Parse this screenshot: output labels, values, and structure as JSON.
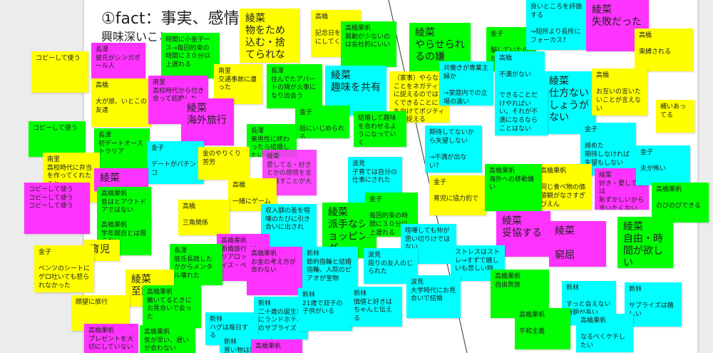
{
  "board": {
    "title": "①fact：事実、感情",
    "subtitle": "興味深いこと",
    "colors": {
      "yellow": "#ffff00",
      "green": "#00ff00",
      "cyan": "#00ffff",
      "magenta": "#ff33ff",
      "canvas": "#ffffff",
      "background": "#ececec"
    }
  },
  "notes": [
    {
      "text": "綾菜\n物をため込む・捨てられない"
    },
    {
      "text": "高橋\n\n記念日を大事にしてくれる"
    },
    {
      "text": "高橋果帆\n異動が少ないのは会社的にいい"
    },
    {
      "text": "綾菜\nやらせられるの嫌"
    },
    {
      "text": "金子\n\n騙していたのがショック"
    },
    {
      "text": "良いところを評価する\n\n→短所より長所にフォーカス？"
    },
    {
      "text": "綾菜\n失敗だった"
    },
    {
      "text": "高橋\n\n束縛される"
    },
    {
      "text": "時間に小金子ース→毎回約束の時間に３０分以上遅れる"
    },
    {
      "text": "長澤\n彼氏がシンガポール人"
    },
    {
      "text": "コピーして使う"
    },
    {
      "text": "高橋\n\n大が旅、いとこの友達"
    },
    {
      "text": "南里\n高校時代から付き合って結婚した"
    },
    {
      "text": "南里\n交通事故に遭った"
    },
    {
      "text": "長澤\n住んでたアパートの隣が火事になり出会う"
    },
    {
      "text": "綾菜\n趣味を共有"
    },
    {
      "text": "（家事）やらないことをネガティブに捉えるのではなくできることに目を向けてポジティブに捉える"
    },
    {
      "text": "共働きが専業主婦か\n\n→家庭内での立場の違い"
    },
    {
      "text": "高橋\n\n不満がない"
    },
    {
      "text": "綾菜\n仕方ないしょうがない"
    },
    {
      "text": "高橋\n\nお互いの言いたいことが言えない"
    },
    {
      "text": "できることだけやればいい。それが不満になるならことはない"
    },
    {
      "text": "綾菜\n海外旅行"
    },
    {
      "text": "金子\n\n話にいじめられる"
    },
    {
      "text": "結婚して趣味を合わせるようになっていく"
    },
    {
      "text": "期待してないから失望しない\n\n→不満が出ない？"
    },
    {
      "text": "金子\n\n諦めた\n期待しなければ失望もしない"
    },
    {
      "text": "補いあってる"
    },
    {
      "text": "コピーして使う"
    },
    {
      "text": "長澤\n初デートオーストラリア"
    },
    {
      "text": "長澤\n美男性に終わったら結婚したい"
    },
    {
      "text": "金子\n\nデートがパチンコ"
    },
    {
      "text": "金のやりくり苦労"
    },
    {
      "text": "綾菜\n愛してる・好きとかの感情を言い表すことが大事"
    },
    {
      "text": "南里\n高校時代に弁当を作ってくれたこと"
    },
    {
      "text": "綾菜"
    },
    {
      "text": "高橋果帆\n\n同じ食べ物の価値観がなさすぎびえん"
    },
    {
      "text": "綾菜\n好き・愛してるは\n恥ずかしいから言いたくない"
    },
    {
      "text": "金子\n\n夫が怖い"
    },
    {
      "text": "コピーして使う\nコピーして使う\nコピーして使う"
    },
    {
      "text": "高橋果帆\n音はとアウトドアではない"
    },
    {
      "text": "高橋\n\n一緒にゲーム"
    },
    {
      "text": "波見\n子育ては自分の仕事にされた"
    },
    {
      "text": "金子\n\n育児に協力的で"
    },
    {
      "text": "高橋果帆\n海外への移動嫌い"
    },
    {
      "text": "高橋果帆\n\nのびのびできる"
    },
    {
      "text": "高橋\n\n三角関係"
    },
    {
      "text": "収入額の差を喧嘩のたびに引き合いに出され"
    },
    {
      "text": "綾菜\n派手なショッピング"
    },
    {
      "text": "金子\n\n毎回約束の時間に３０分以上遅れる"
    },
    {
      "text": "綾菜\n妥協する"
    },
    {
      "text": "綾菜\n\n窮屈"
    },
    {
      "text": "綾菜\n自由・時間が欲しい"
    },
    {
      "text": "高橋果帆\n学年開自とは限らない"
    },
    {
      "text": "育児"
    },
    {
      "text": "高橋果帆\n新婚旅行イタリアロッパスイス・ペ…"
    },
    {
      "text": "喧嘩しても仲が思い切りけではない"
    },
    {
      "text": "ストレスはストレ→すずて嬉しいも悲しい時"
    },
    {
      "text": "長澤\n彼氏長政したかからメンタル壊れた"
    },
    {
      "text": "高橋果帆\nお金の考え方が合わない"
    },
    {
      "text": "新林\n節約指輪と結婚指輪、入院のピアオが宝物"
    },
    {
      "text": "波見\n周りの友人のじられた"
    },
    {
      "text": "高橋果帆\n自由奔放"
    },
    {
      "text": "金子\n\nベンツのシートにゲロ吐いても怒られなかった"
    },
    {
      "text": "綾菜\n至飼"
    },
    {
      "text": "高橋果帆\n働いてるときに\nお見合いで会った"
    },
    {
      "text": "新林\n二十歳の誕生日にランドホテルのサプライズ"
    },
    {
      "text": "新林\n21歳で双子の子供がいる"
    },
    {
      "text": "新林\n価値と好きはちゃんと伝える"
    },
    {
      "text": "波見\n大学時代にお見合いで結婚"
    },
    {
      "text": "新林\n\nすっと会えない時期が長い"
    },
    {
      "text": "新林\n\nサプライズは嬉しい"
    },
    {
      "text": "顔望に旅行"
    },
    {
      "text": "高橋果帆\n\n平和主義"
    },
    {
      "text": "高橋果帆\n\nなるべくケチしたい"
    },
    {
      "text": "高橋果帆\nプレゼントを大切にしていない"
    },
    {
      "text": "高橋果帆\n気が早い、遅いが合わない"
    },
    {
      "text": "新林\nハグは毎日する"
    },
    {
      "text": "新林\n買い物は遊び"
    },
    {
      "text": "高橋果帆"
    }
  ]
}
